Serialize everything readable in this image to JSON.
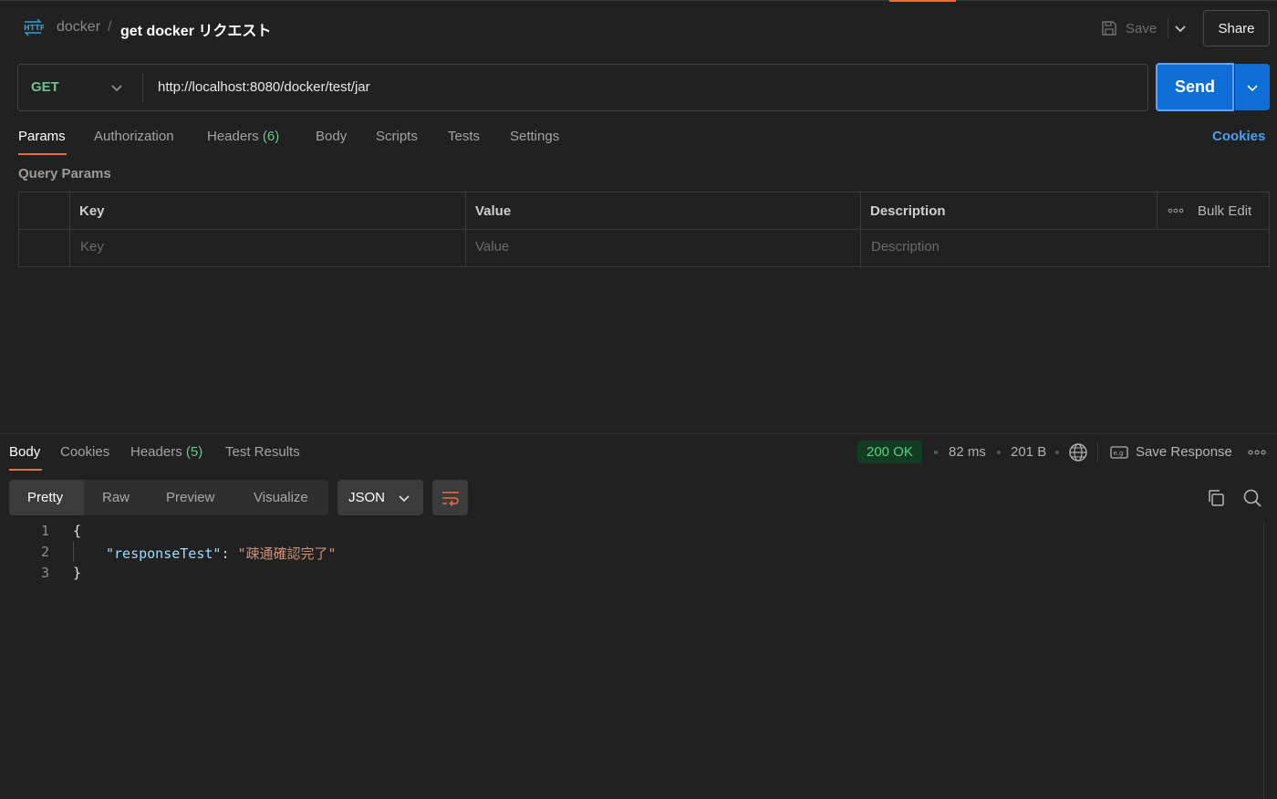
{
  "header": {
    "breadcrumb_parent": "docker",
    "breadcrumb_separator": "/",
    "request_name": "get docker リクエスト",
    "save_label": "Save",
    "share_label": "Share"
  },
  "request": {
    "method": "GET",
    "url": "http://localhost:8080/docker/test/jar",
    "send_label": "Send"
  },
  "request_tabs": {
    "params": "Params",
    "authorization": "Authorization",
    "headers": "Headers",
    "headers_count": "(6)",
    "body": "Body",
    "scripts": "Scripts",
    "tests": "Tests",
    "settings": "Settings",
    "cookies": "Cookies"
  },
  "query_params": {
    "title": "Query Params",
    "columns": {
      "key": "Key",
      "value": "Value",
      "description": "Description"
    },
    "bulk_edit": "Bulk Edit",
    "placeholders": {
      "key": "Key",
      "value": "Value",
      "description": "Description"
    }
  },
  "response_tabs": {
    "body": "Body",
    "cookies": "Cookies",
    "headers": "Headers",
    "headers_count": "(5)",
    "test_results": "Test Results"
  },
  "response_meta": {
    "status": "200 OK",
    "time": "82 ms",
    "size": "201 B",
    "save_response": "Save Response"
  },
  "format": {
    "pretty": "Pretty",
    "raw": "Raw",
    "preview": "Preview",
    "visualize": "Visualize",
    "language": "JSON"
  },
  "code": {
    "line_numbers": [
      "1",
      "2",
      "3"
    ],
    "open_brace": "{",
    "key": "\"responseTest\"",
    "colon": ":",
    "value": "\"疎通確認完了\"",
    "close_brace": "}"
  },
  "colors": {
    "accent_orange": "#f26b3a",
    "send_blue": "#0d6fd6",
    "method_green": "#6cc488",
    "status_green": "#55d17f",
    "link_blue": "#4a9ff5"
  }
}
